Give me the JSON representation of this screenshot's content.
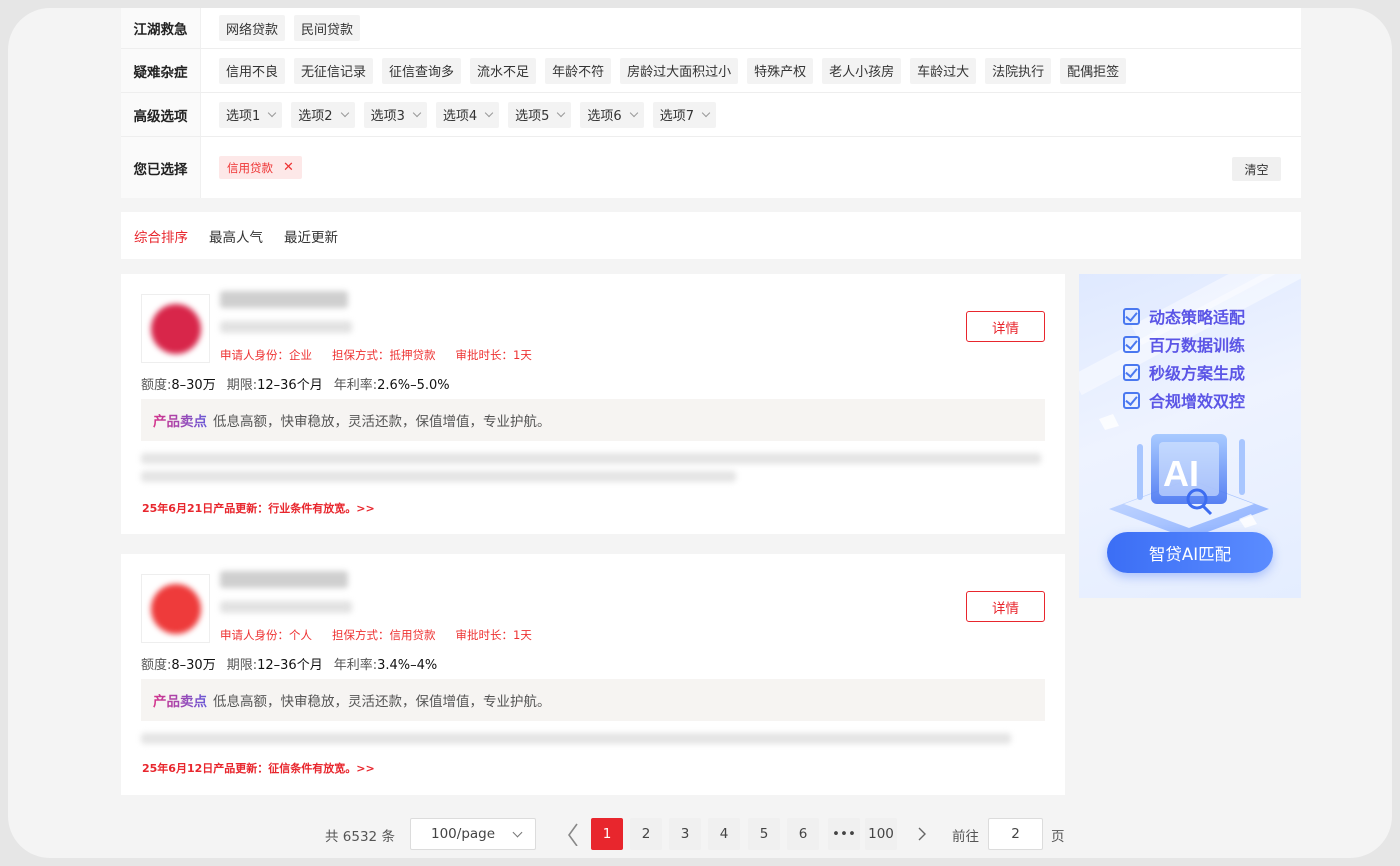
{
  "filters": {
    "rows": [
      {
        "label": "江湖救急",
        "options": [
          "网络贷款",
          "民间贷款"
        ]
      },
      {
        "label": "疑难杂症",
        "options": [
          "信用不良",
          "无征信记录",
          "征信查询多",
          "流水不足",
          "年龄不符",
          "房龄过大面积过小",
          "特殊产权",
          "老人小孩房",
          "车龄过大",
          "法院执行",
          "配偶拒签"
        ]
      },
      {
        "label": "高级选项",
        "options": [
          "选项1",
          "选项2",
          "选项3",
          "选项4",
          "选项5",
          "选项6",
          "选项7"
        ]
      }
    ],
    "selected_label": "您已选择",
    "selected_tags": [
      "信用贷款"
    ],
    "clear_label": "清空"
  },
  "sort": {
    "options": [
      "综合排序",
      "最高人气",
      "最近更新"
    ],
    "active": "综合排序"
  },
  "products": [
    {
      "meta": [
        "申请人身份：企业",
        "担保方式：抵押贷款",
        "审批时长：1天"
      ],
      "amount_label": "额度:",
      "amount": "8–30万",
      "term_label": "期限:",
      "term": "12–36个月",
      "rate_label": "年利率:",
      "rate": "2.6%–5.0%",
      "detail_label": "详情",
      "selling_label": "产品卖点",
      "selling_text": "低息高额，快审稳放，灵活还款，保值增值，专业护航。",
      "update_text": "25年6月21日产品更新：行业条件有放宽。>>",
      "logo_color": "#d8264a"
    },
    {
      "meta": [
        "申请人身份：个人",
        "担保方式：信用贷款",
        "审批时长：1天"
      ],
      "amount_label": "额度:",
      "amount": "8–30万",
      "term_label": "期限:",
      "term": "12–36个月",
      "rate_label": "年利率:",
      "rate": "3.4%–4%",
      "detail_label": "详情",
      "selling_label": "产品卖点",
      "selling_text": "低息高额，快审稳放，灵活还款，保值增值，专业护航。",
      "update_text": "25年6月12日产品更新：征信条件有放宽。>>",
      "logo_color": "#ee3b3b"
    }
  ],
  "ad": {
    "features": [
      "动态策略适配",
      "百万数据训练",
      "秒级方案生成",
      "合规增效双控"
    ],
    "button_label": "智贷AI匹配",
    "graphic_text": "AI"
  },
  "pagination": {
    "total_text": "共 6532 条",
    "page_size": "100/page",
    "pages": [
      "1",
      "2",
      "3",
      "4",
      "5",
      "6",
      "•••",
      "100"
    ],
    "current": "1",
    "goto_label": "前往",
    "goto_value": "2",
    "page_suffix": "页"
  }
}
